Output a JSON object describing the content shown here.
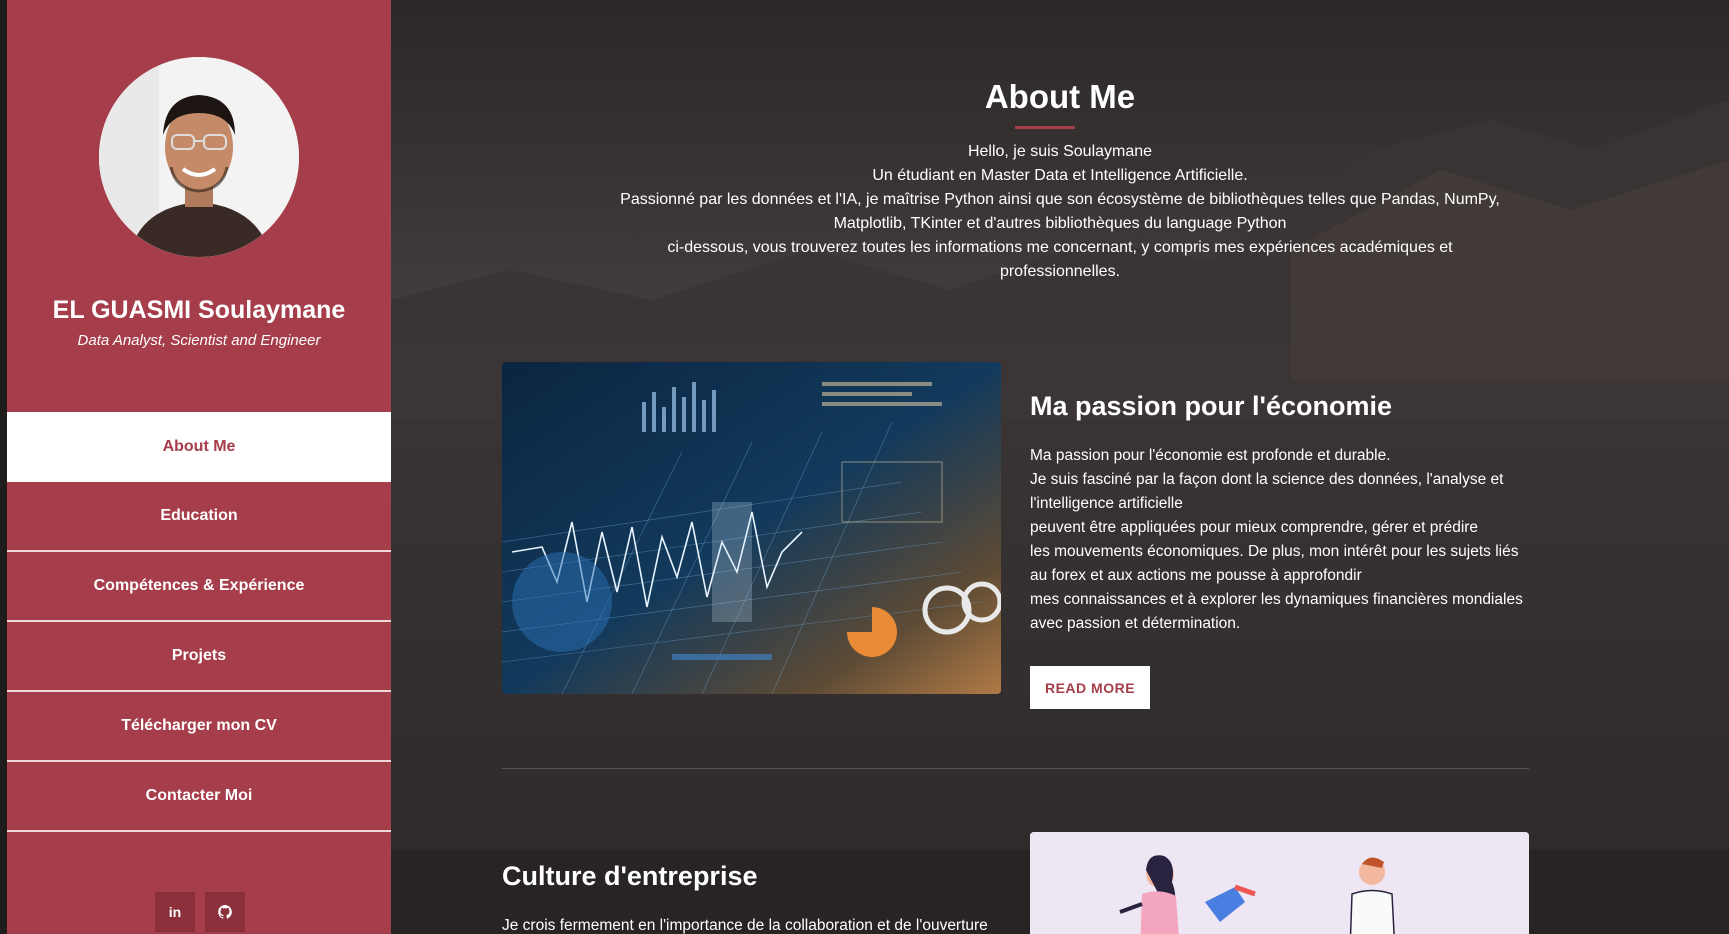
{
  "sidebar": {
    "name": "EL GUASMI Soulaymane",
    "role": "Data Analyst, Scientist and Engineer",
    "nav": [
      {
        "label": "About Me",
        "active": true
      },
      {
        "label": "Education",
        "active": false
      },
      {
        "label": "Compétences & Expérience",
        "active": false
      },
      {
        "label": "Projets",
        "active": false
      },
      {
        "label": "Télécharger mon CV",
        "active": false
      },
      {
        "label": "Contacter Moi",
        "active": false
      }
    ],
    "social": [
      {
        "icon": "linkedin-icon",
        "label": "in"
      },
      {
        "icon": "github-icon",
        "label": "⌂"
      }
    ]
  },
  "about": {
    "title": "About Me",
    "intro_lines": [
      "Hello, je suis Soulaymane",
      "Un étudiant en Master Data et Intelligence Artificielle.",
      "Passionné par les données et l'IA, je maîtrise Python ainsi que son écosystème de bibliothèques telles que Pandas, NumPy,",
      "Matplotlib, TKinter et d'autres bibliothèques du language Python",
      "ci-dessous, vous trouverez toutes les informations me concernant, y compris mes expériences académiques et",
      "professionnelles."
    ]
  },
  "section1": {
    "title": "Ma passion pour l'économie",
    "lines": [
      "Ma passion pour l'économie est profonde et durable.",
      "Je suis fasciné par la façon dont la science des données, l'analyse et",
      "l'intelligence artificielle",
      "peuvent être appliquées pour mieux comprendre, gérer et prédire",
      "les mouvements économiques. De plus, mon intérêt pour les sujets liés",
      "au forex et aux actions me pousse à approfondir",
      "mes connaissances et à explorer les dynamiques financières mondiales",
      "avec passion et détermination."
    ],
    "button": "READ MORE"
  },
  "section2": {
    "title": "Culture d'entreprise",
    "text": "Je crois fermement en l'importance de la collaboration et de l'ouverture"
  },
  "colors": {
    "accent": "#a63d4a",
    "dark": "#2a2626",
    "white": "#ffffff"
  }
}
